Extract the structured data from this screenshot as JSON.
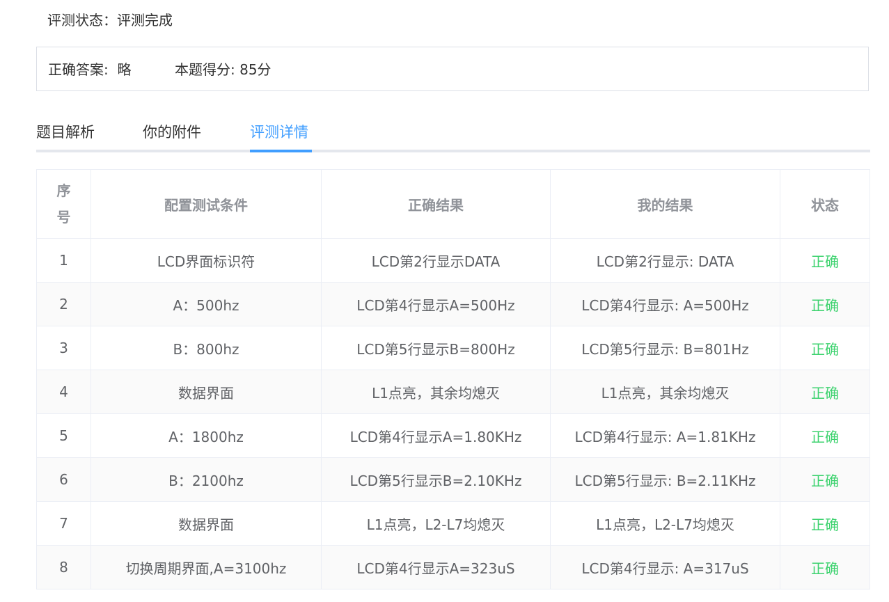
{
  "status": {
    "label": "评测状态：",
    "value": "评测完成"
  },
  "answer": {
    "label": "正确答案:",
    "value": "略",
    "score_label": "本题得分:",
    "score_value": "85分"
  },
  "tabs": [
    {
      "label": "题目解析"
    },
    {
      "label": "你的附件"
    },
    {
      "label": "评测详情",
      "active": true
    }
  ],
  "colors": {
    "accent": "#409eff",
    "ok": "#3cd26e"
  },
  "table": {
    "headers": [
      "序号",
      "配置测试条件",
      "正确结果",
      "我的结果",
      "状态"
    ],
    "rows": [
      {
        "idx": "1",
        "cond": "LCD界面标识符",
        "expected": "LCD第2行显示DATA",
        "mine": "LCD第2行显示: DATA",
        "state": "正确"
      },
      {
        "idx": "2",
        "cond": "A：500hz",
        "expected": "LCD第4行显示A=500Hz",
        "mine": "LCD第4行显示: A=500Hz",
        "state": "正确"
      },
      {
        "idx": "3",
        "cond": "B：800hz",
        "expected": "LCD第5行显示B=800Hz",
        "mine": "LCD第5行显示: B=801Hz",
        "state": "正确"
      },
      {
        "idx": "4",
        "cond": "数据界面",
        "expected": "L1点亮，其余均熄灭",
        "mine": "L1点亮，其余均熄灭",
        "state": "正确"
      },
      {
        "idx": "5",
        "cond": "A：1800hz",
        "expected": "LCD第4行显示A=1.80KHz",
        "mine": "LCD第4行显示: A=1.81KHz",
        "state": "正确"
      },
      {
        "idx": "6",
        "cond": "B：2100hz",
        "expected": "LCD第5行显示B=2.10KHz",
        "mine": "LCD第5行显示: B=2.11KHz",
        "state": "正确"
      },
      {
        "idx": "7",
        "cond": "数据界面",
        "expected": "L1点亮，L2-L7均熄灭",
        "mine": "L1点亮，L2-L7均熄灭",
        "state": "正确"
      },
      {
        "idx": "8",
        "cond": "切换周期界面,A=3100hz",
        "expected": "LCD第4行显示A=323uS",
        "mine": "LCD第4行显示: A=317uS",
        "state": "正确"
      }
    ]
  }
}
